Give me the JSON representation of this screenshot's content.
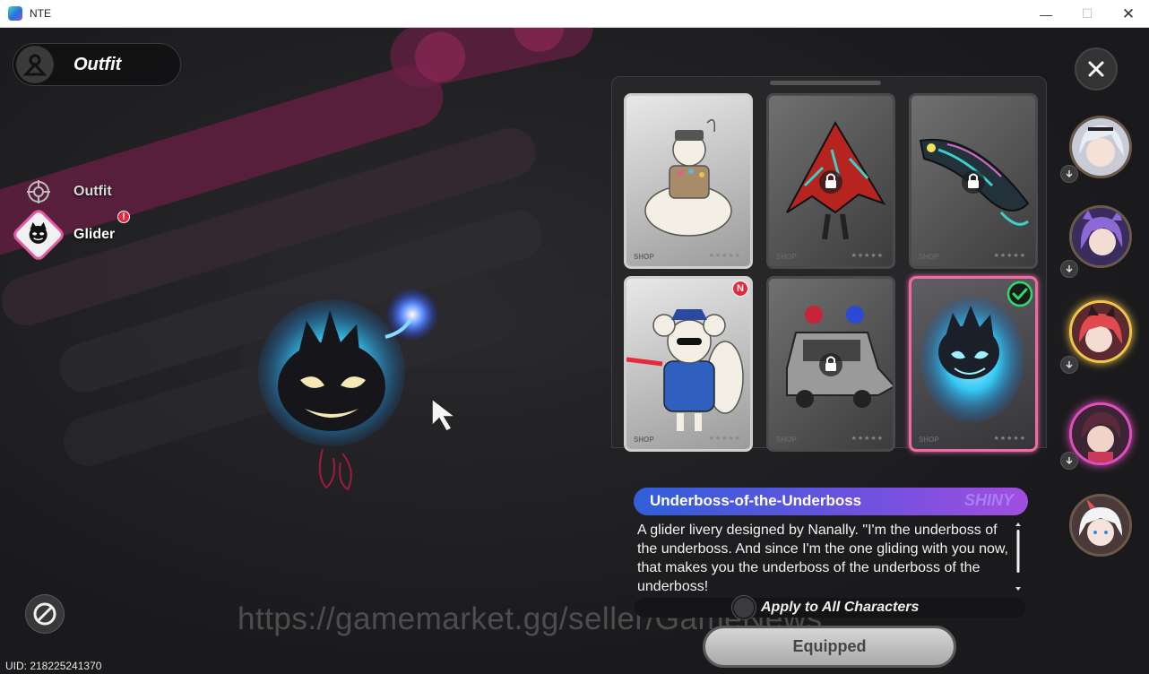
{
  "window": {
    "title": "NTE",
    "min_glyph": "—",
    "max_glyph": "☐",
    "close_glyph": "✕"
  },
  "header": {
    "title": "Outfit"
  },
  "categories": [
    {
      "label": "Outfit",
      "icon": "crosshair-icon",
      "selected": false
    },
    {
      "label": "Glider",
      "icon": "glider-icon",
      "selected": true,
      "badge": "!"
    }
  ],
  "items": [
    {
      "name": "cat-glider",
      "tag": "SHOP",
      "locked": false,
      "new": false,
      "equipped": false,
      "featured": true
    },
    {
      "name": "red-kite-glider",
      "tag": "SHOP",
      "locked": true,
      "new": false,
      "equipped": false,
      "featured": false
    },
    {
      "name": "koi-streamer-glider",
      "tag": "SHOP",
      "locked": true,
      "new": false,
      "equipped": false,
      "featured": false
    },
    {
      "name": "police-mouse-glider",
      "tag": "SHOP",
      "locked": false,
      "new": true,
      "new_label": "N",
      "equipped": false,
      "featured": true
    },
    {
      "name": "police-car-glider",
      "tag": "SHOP",
      "locked": true,
      "new": false,
      "equipped": false,
      "featured": false
    },
    {
      "name": "blue-flame-ghost-glider",
      "tag": "SHOP",
      "locked": false,
      "new": false,
      "equipped": true,
      "featured": false
    }
  ],
  "selected_item": {
    "name": "Underboss-of-the-Underboss",
    "rarity": "SHINY",
    "description": "A glider livery designed by Nanally. \"I'm the underboss of the underboss. And since I'm the one gliding with you now, that makes you the underboss of the underboss of the underboss!"
  },
  "apply_all": {
    "label": "Apply to All Characters",
    "checked": false
  },
  "equip_button": {
    "label": "Equipped"
  },
  "uid": "UID: 218225241370",
  "watermark": "https://gamemarket.gg/seller/GameNews",
  "colors": {
    "accent_pink": "#e25aa5",
    "name_bar_start": "#2f5fd9",
    "name_bar_end": "#a24ee0",
    "active_gold": "#f0c54a"
  },
  "roster": [
    {
      "name": "silver-hair-character",
      "active": false
    },
    {
      "name": "purple-hair-character",
      "active": false
    },
    {
      "name": "red-hair-character",
      "active": true
    },
    {
      "name": "dark-hair-male-character",
      "active": true
    },
    {
      "name": "white-hair-horned-character",
      "active": false
    }
  ]
}
